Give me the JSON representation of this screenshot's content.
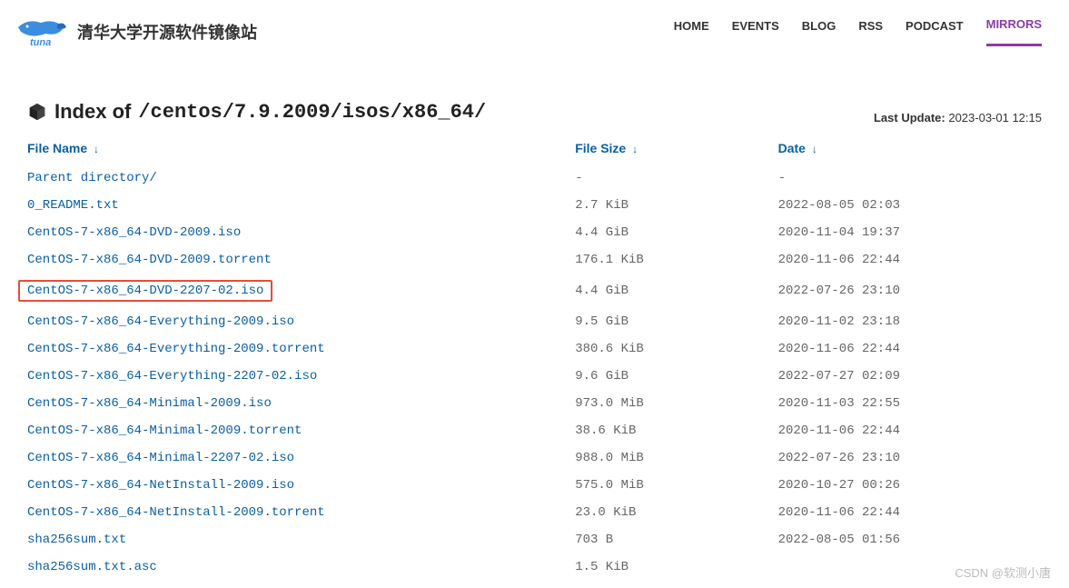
{
  "site": {
    "title": "清华大学开源软件镜像站"
  },
  "nav": [
    {
      "label": "HOME",
      "active": false
    },
    {
      "label": "EVENTS",
      "active": false
    },
    {
      "label": "BLOG",
      "active": false
    },
    {
      "label": "RSS",
      "active": false
    },
    {
      "label": "PODCAST",
      "active": false
    },
    {
      "label": "MIRRORS",
      "active": true
    }
  ],
  "page": {
    "title_prefix": "Index of ",
    "path": "/centos/7.9.2009/isos/x86_64/",
    "last_update_label": "Last Update:",
    "last_update_value": "2023-03-01 12:15"
  },
  "columns": {
    "name": "File Name",
    "size": "File Size",
    "date": "Date"
  },
  "files": [
    {
      "name": "Parent directory/",
      "size": "-",
      "date": "-",
      "highlighted": false
    },
    {
      "name": "0_README.txt",
      "size": "2.7 KiB",
      "date": "2022-08-05 02:03",
      "highlighted": false
    },
    {
      "name": "CentOS-7-x86_64-DVD-2009.iso",
      "size": "4.4 GiB",
      "date": "2020-11-04 19:37",
      "highlighted": false
    },
    {
      "name": "CentOS-7-x86_64-DVD-2009.torrent",
      "size": "176.1 KiB",
      "date": "2020-11-06 22:44",
      "highlighted": false
    },
    {
      "name": "CentOS-7-x86_64-DVD-2207-02.iso",
      "size": "4.4 GiB",
      "date": "2022-07-26 23:10",
      "highlighted": true
    },
    {
      "name": "CentOS-7-x86_64-Everything-2009.iso",
      "size": "9.5 GiB",
      "date": "2020-11-02 23:18",
      "highlighted": false
    },
    {
      "name": "CentOS-7-x86_64-Everything-2009.torrent",
      "size": "380.6 KiB",
      "date": "2020-11-06 22:44",
      "highlighted": false
    },
    {
      "name": "CentOS-7-x86_64-Everything-2207-02.iso",
      "size": "9.6 GiB",
      "date": "2022-07-27 02:09",
      "highlighted": false
    },
    {
      "name": "CentOS-7-x86_64-Minimal-2009.iso",
      "size": "973.0 MiB",
      "date": "2020-11-03 22:55",
      "highlighted": false
    },
    {
      "name": "CentOS-7-x86_64-Minimal-2009.torrent",
      "size": "38.6 KiB",
      "date": "2020-11-06 22:44",
      "highlighted": false
    },
    {
      "name": "CentOS-7-x86_64-Minimal-2207-02.iso",
      "size": "988.0 MiB",
      "date": "2022-07-26 23:10",
      "highlighted": false
    },
    {
      "name": "CentOS-7-x86_64-NetInstall-2009.iso",
      "size": "575.0 MiB",
      "date": "2020-10-27 00:26",
      "highlighted": false
    },
    {
      "name": "CentOS-7-x86_64-NetInstall-2009.torrent",
      "size": "23.0 KiB",
      "date": "2020-11-06 22:44",
      "highlighted": false
    },
    {
      "name": "sha256sum.txt",
      "size": "703 B",
      "date": "2022-08-05 01:56",
      "highlighted": false
    },
    {
      "name": "sha256sum.txt.asc",
      "size": "1.5 KiB",
      "date": "",
      "highlighted": false
    }
  ],
  "watermark": "CSDN @软测小唐"
}
